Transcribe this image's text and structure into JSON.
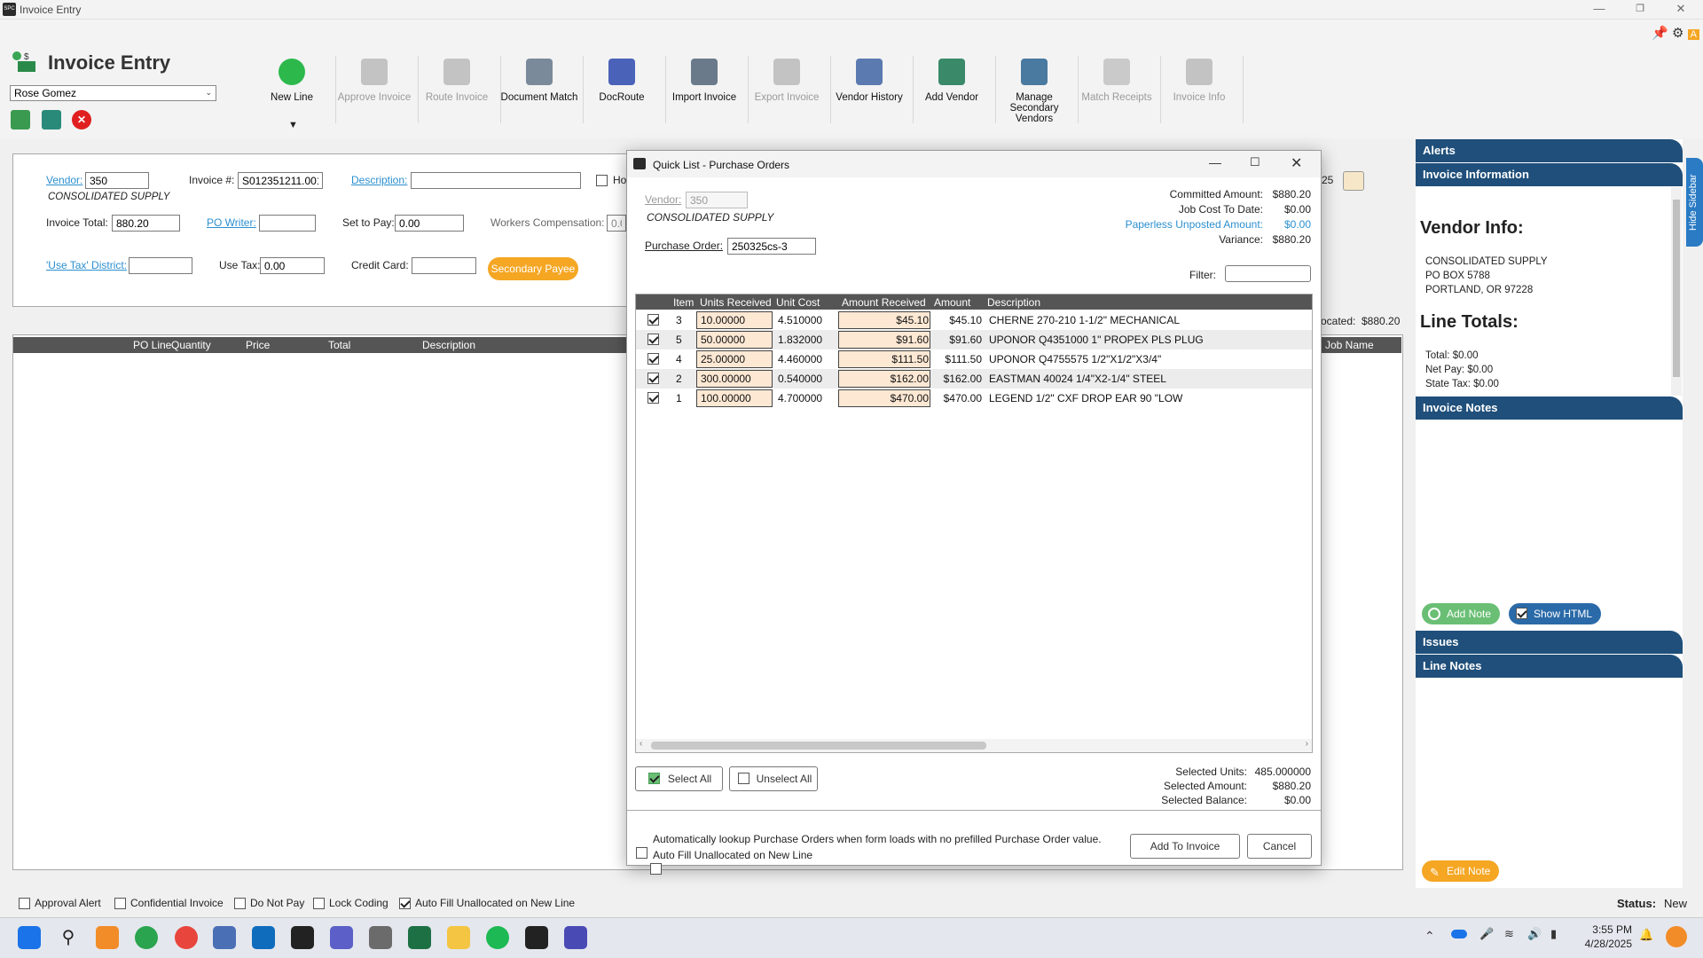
{
  "window": {
    "title": "Invoice Entry"
  },
  "app": {
    "title": "Invoice Entry",
    "user": "Rose Gomez"
  },
  "ribbon": {
    "buttons": [
      {
        "label": "New Line",
        "enabled": true
      },
      {
        "label": "Approve Invoice",
        "enabled": false
      },
      {
        "label": "Route Invoice",
        "enabled": false
      },
      {
        "label": "Document Match",
        "enabled": true
      },
      {
        "label": "DocRoute",
        "enabled": true
      },
      {
        "label": "Import Invoice",
        "enabled": true
      },
      {
        "label": "Export Invoice",
        "enabled": false
      },
      {
        "label": "Vendor History",
        "enabled": true
      },
      {
        "label": "Add Vendor",
        "enabled": true
      },
      {
        "label": "Manage Secondary Vendors",
        "enabled": true
      },
      {
        "label": "Match Receipts",
        "enabled": false
      },
      {
        "label": "Invoice Info",
        "enabled": false
      }
    ],
    "new_line_arrow": "▼"
  },
  "form": {
    "vendor_label": "Vendor:",
    "vendor_value": "350",
    "vendor_name": "CONSOLIDATED SUPPLY",
    "invoice_no_label": "Invoice #:",
    "invoice_no_value": "S012351211.001",
    "description_label": "Description:",
    "description_value": "",
    "hold_label": "Ho",
    "invoice_total_label": "Invoice Total:",
    "invoice_total_value": "880.20",
    "po_writer_label": "PO Writer:",
    "po_writer_value": "",
    "set_to_pay_label": "Set to Pay:",
    "set_to_pay_value": "0.00",
    "workers_comp_label": "Workers Compensation:",
    "workers_comp_value": "0.0",
    "use_tax_district_label": "'Use Tax' District:",
    "use_tax_district_value": "",
    "use_tax_label": "Use Tax:",
    "use_tax_value": "0.00",
    "credit_card_label": "Credit Card:",
    "credit_card_value": "",
    "secondary_payee": "Secondary Payee",
    "right_date_fragment": "25",
    "allocated_label": "ocated:",
    "allocated_value": "$880.20"
  },
  "grid": {
    "columns": [
      "PO Line",
      "Quantity",
      "Price",
      "Total",
      "Description"
    ],
    "right_column": "Job Name"
  },
  "bottom": {
    "checkboxes": [
      {
        "label": "Approval Alert",
        "checked": false
      },
      {
        "label": "Confidential Invoice",
        "checked": false
      },
      {
        "label": "Do Not Pay",
        "checked": false
      },
      {
        "label": "Lock Coding",
        "checked": false
      },
      {
        "label": "Auto Fill Unallocated on New Line",
        "checked": true
      }
    ],
    "status_label": "Status:",
    "status_value": "New"
  },
  "sidebar": {
    "alerts": "Alerts",
    "invoice_information": "Invoice Information",
    "vendor_info_title": "Vendor Info:",
    "vendor_lines": [
      "CONSOLIDATED SUPPLY",
      "PO BOX 5788",
      "PORTLAND, OR 97228"
    ],
    "line_totals_title": "Line Totals:",
    "totals": [
      {
        "label": "Total:",
        "value": "$0.00"
      },
      {
        "label": "Net Pay:",
        "value": "$0.00"
      },
      {
        "label": "State Tax:",
        "value": "$0.00"
      }
    ],
    "invoice_notes": "Invoice Notes",
    "add_note": "Add Note",
    "show_html": "Show HTML",
    "issues": "Issues",
    "line_notes": "Line Notes",
    "edit_note": "Edit Note",
    "hide_sidebar": "Hide Sidebar"
  },
  "dialog": {
    "title": "Quick List - Purchase Orders",
    "vendor_label": "Vendor:",
    "vendor_value": "350",
    "vendor_name": "CONSOLIDATED SUPPLY",
    "po_label": "Purchase Order:",
    "po_value": "250325cs-3",
    "filter_label": "Filter:",
    "filter_value": "",
    "summary": [
      {
        "label": "Committed Amount:",
        "value": "$880.20",
        "link": false
      },
      {
        "label": "Job Cost To Date:",
        "value": "$0.00",
        "link": false
      },
      {
        "label": "Paperless Unposted Amount:",
        "value": "$0.00",
        "link": true
      },
      {
        "label": "Variance:",
        "value": "$880.20",
        "link": false
      }
    ],
    "columns": [
      "Item",
      "Units Received",
      "Unit Cost",
      "Amount Received",
      "Amount",
      "Description"
    ],
    "rows": [
      {
        "checked": true,
        "item": "3",
        "units": "10.00000",
        "unit_cost": "4.510000",
        "amount_received": "$45.10",
        "amount": "$45.10",
        "description": "CHERNE 270-210 1-1/2\" MECHANICAL"
      },
      {
        "checked": true,
        "item": "5",
        "units": "50.00000",
        "unit_cost": "1.832000",
        "amount_received": "$91.60",
        "amount": "$91.60",
        "description": "UPONOR Q4351000 1\" PROPEX PLS PLUG"
      },
      {
        "checked": true,
        "item": "4",
        "units": "25.00000",
        "unit_cost": "4.460000",
        "amount_received": "$111.50",
        "amount": "$111.50",
        "description": "UPONOR Q4755575 1/2\"X1/2\"X3/4\""
      },
      {
        "checked": true,
        "item": "2",
        "units": "300.00000",
        "unit_cost": "0.540000",
        "amount_received": "$162.00",
        "amount": "$162.00",
        "description": "EASTMAN 40024 1/4\"X2-1/4\" STEEL"
      },
      {
        "checked": true,
        "item": "1",
        "units": "100.00000",
        "unit_cost": "4.700000",
        "amount_received": "$470.00",
        "amount": "$470.00",
        "description": "LEGEND 1/2\" CXF DROP EAR 90 \"LOW"
      }
    ],
    "select_all": "Select All",
    "unselect_all": "Unselect All",
    "selected": [
      {
        "label": "Selected Units:",
        "value": "485.000000"
      },
      {
        "label": "Selected Amount:",
        "value": "$880.20"
      },
      {
        "label": "Selected Balance:",
        "value": "$0.00"
      }
    ],
    "auto_lookup": "Automatically lookup Purchase Orders when form loads with no prefilled Purchase Order value.",
    "auto_fill": "Auto Fill Unallocated on New Line",
    "add_to_invoice": "Add To Invoice",
    "cancel": "Cancel"
  },
  "taskbar": {
    "time": "3:55 PM",
    "date": "4/28/2025"
  },
  "colors": {
    "accent": "#2b8fd0",
    "header_dark": "#1f4f7a",
    "orange": "#f5a623",
    "grid_header": "#555555"
  }
}
